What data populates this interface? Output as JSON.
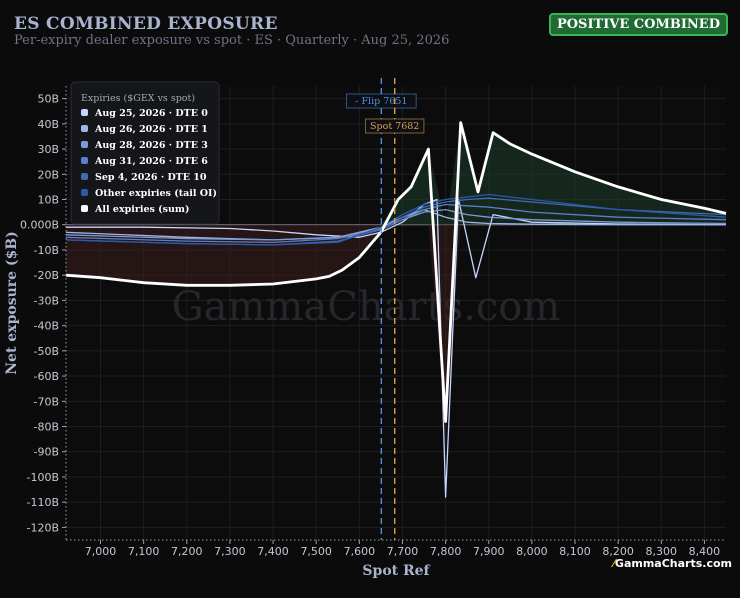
{
  "header": {
    "title": "ES COMBINED EXPOSURE",
    "subtitle": "Per-expiry dealer exposure vs spot · ES · Quarterly · Aug 25, 2026",
    "badge": "POSITIVE COMBINED",
    "brand": "GammaCharts.com"
  },
  "colors": {
    "background": "#0b0b0c",
    "plot_bg": "#0c0c0d",
    "badge": "#1f6b33",
    "flip": "#4f8fe0",
    "spot": "#d9a14a",
    "sum": "#ffffff",
    "positive_fill": "#1d3a26",
    "negative_fill": "#3a1d1d"
  },
  "chart_data": {
    "type": "line",
    "watermark": "GammaCharts.com",
    "xlabel": "Spot Ref",
    "ylabel": "Net exposure ($B)",
    "xlim": [
      6920,
      8450
    ],
    "ylim": [
      -125,
      55
    ],
    "x_ticks": [
      7000,
      7100,
      7200,
      7300,
      7400,
      7500,
      7600,
      7700,
      7800,
      7900,
      8000,
      8100,
      8200,
      8300,
      8400
    ],
    "x_tick_labels": [
      "7,000",
      "7,100",
      "7,200",
      "7,300",
      "7,400",
      "7,500",
      "7,600",
      "7,700",
      "7,800",
      "7,900",
      "8,000",
      "8,100",
      "8,200",
      "8,300",
      "8,400"
    ],
    "y_ticks": [
      50,
      40,
      30,
      20,
      10,
      0,
      -10,
      -20,
      -30,
      -40,
      -50,
      -60,
      -70,
      -80,
      -90,
      -100,
      -110,
      -120
    ],
    "y_tick_labels": [
      "50B",
      "40B",
      "30B",
      "20B",
      "10B",
      "0.000B",
      "-10B",
      "-20B",
      "-30B",
      "-40B",
      "-50B",
      "-60B",
      "-70B",
      "-80B",
      "-90B",
      "-100B",
      "-110B",
      "-120B"
    ],
    "grid": true,
    "legend": {
      "title": "Expiries ($GEX vs spot)",
      "placement": "top-left"
    },
    "markers": [
      {
        "label": "- Flip 7651",
        "x": 7651,
        "color": "#4f8fe0"
      },
      {
        "label": "Spot 7682",
        "x": 7682,
        "color": "#d9a14a"
      }
    ],
    "series": [
      {
        "name": "Aug 25, 2026 · DTE 0",
        "color": "#c6d4ff",
        "width": 1.3,
        "x": [
          6920,
          7100,
          7300,
          7400,
          7500,
          7600,
          7650,
          7700,
          7750,
          7780,
          7800,
          7830,
          7870,
          7910,
          8000,
          8200,
          8450
        ],
        "y": [
          -1,
          -1,
          -1.5,
          -2.5,
          -4,
          -5,
          -3,
          1,
          8,
          10,
          -108,
          10,
          -21,
          4,
          1,
          0.3,
          0
        ]
      },
      {
        "name": "Aug 26, 2026 · DTE 1",
        "color": "#9fb4e8",
        "width": 1.3,
        "x": [
          6920,
          7200,
          7400,
          7550,
          7650,
          7700,
          7750,
          7800,
          7850,
          7900,
          8000,
          8200,
          8450
        ],
        "y": [
          -3,
          -5,
          -6,
          -5,
          -1,
          3,
          6,
          3,
          1,
          0.5,
          0.2,
          0,
          0
        ]
      },
      {
        "name": "Aug 28, 2026 · DTE 3",
        "color": "#7b9bd8",
        "width": 1.3,
        "x": [
          6920,
          7200,
          7400,
          7550,
          7650,
          7700,
          7750,
          7800,
          7850,
          7900,
          8000,
          8200,
          8450
        ],
        "y": [
          -4,
          -5.5,
          -6,
          -5,
          -1.5,
          2,
          5,
          6,
          4,
          3,
          2,
          1,
          0.5
        ]
      },
      {
        "name": "Aug 31, 2026 · DTE 6",
        "color": "#5b80c8",
        "width": 1.3,
        "x": [
          6920,
          7200,
          7400,
          7550,
          7650,
          7700,
          7750,
          7800,
          7850,
          7900,
          8000,
          8200,
          8450
        ],
        "y": [
          -5,
          -6.5,
          -7,
          -5.5,
          -2,
          2,
          6,
          8,
          7.5,
          7,
          5,
          3,
          2
        ]
      },
      {
        "name": "Sep 4, 2026 · DTE 10",
        "color": "#4369b0",
        "width": 1.3,
        "x": [
          6920,
          7200,
          7400,
          7550,
          7650,
          7700,
          7750,
          7800,
          7850,
          7900,
          8000,
          8200,
          8450
        ],
        "y": [
          -6,
          -7.5,
          -8,
          -6.5,
          -2,
          3,
          7,
          9,
          10,
          10.5,
          9,
          6,
          4
        ]
      },
      {
        "name": "Other expiries (tail OI)",
        "color": "#2b5aa8",
        "width": 1.3,
        "x": [
          6920,
          7200,
          7400,
          7550,
          7650,
          7700,
          7750,
          7800,
          7850,
          7900,
          8000,
          8200,
          8450
        ],
        "y": [
          -6,
          -7.5,
          -8,
          -7,
          -1,
          4,
          8,
          10,
          11,
          12,
          10,
          6,
          3
        ]
      },
      {
        "name": "All expiries (sum)",
        "color": "#ffffff",
        "width": 2.8,
        "x": [
          6920,
          7000,
          7100,
          7200,
          7300,
          7400,
          7500,
          7530,
          7560,
          7600,
          7650,
          7690,
          7720,
          7760,
          7800,
          7835,
          7875,
          7910,
          7950,
          8000,
          8100,
          8200,
          8300,
          8400,
          8450
        ],
        "y": [
          -20,
          -21,
          -23,
          -24,
          -24,
          -23.5,
          -21.5,
          -20.5,
          -18,
          -13,
          -3,
          10,
          15,
          30,
          -78,
          40.5,
          13,
          36.5,
          32,
          28,
          21,
          15,
          10,
          6.5,
          4.5
        ]
      }
    ]
  }
}
